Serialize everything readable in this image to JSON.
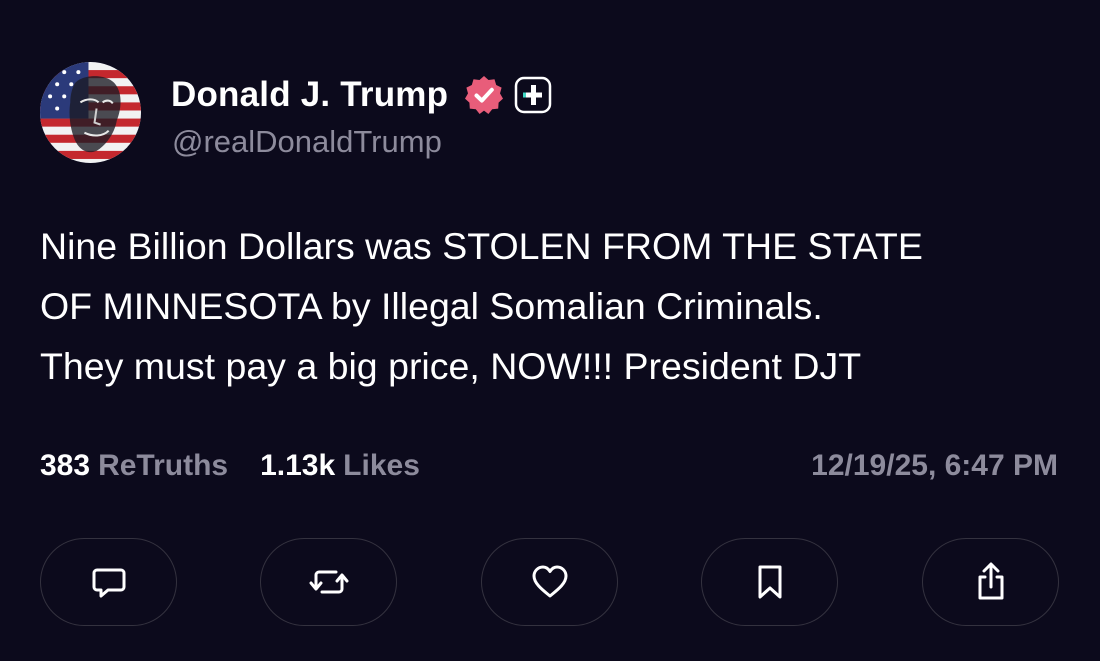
{
  "author": {
    "display_name": "Donald J. Trump",
    "handle": "@realDonaldTrump",
    "verified": true
  },
  "post": {
    "text": "Nine Billion Dollars was STOLEN FROM THE STATE\nOF MINNESOTA by Illegal Somalian Criminals.\nThey must pay a big price, NOW!!! President DJT"
  },
  "stats": {
    "retruths_count": "383",
    "retruths_label": "ReTruths",
    "likes_count": "1.13k",
    "likes_label": "Likes",
    "timestamp": "12/19/25, 6:47 PM"
  },
  "actions": [
    {
      "name": "reply",
      "icon": "comment-icon"
    },
    {
      "name": "retruth",
      "icon": "repost-icon"
    },
    {
      "name": "like",
      "icon": "heart-icon"
    },
    {
      "name": "bookmark",
      "icon": "bookmark-icon"
    },
    {
      "name": "share",
      "icon": "share-icon"
    }
  ],
  "colors": {
    "background": "#0c0a1c",
    "text_primary": "#ffffff",
    "text_secondary": "#8d8b9c",
    "verified_badge": "#e85d7a",
    "button_border": "#34323f"
  }
}
